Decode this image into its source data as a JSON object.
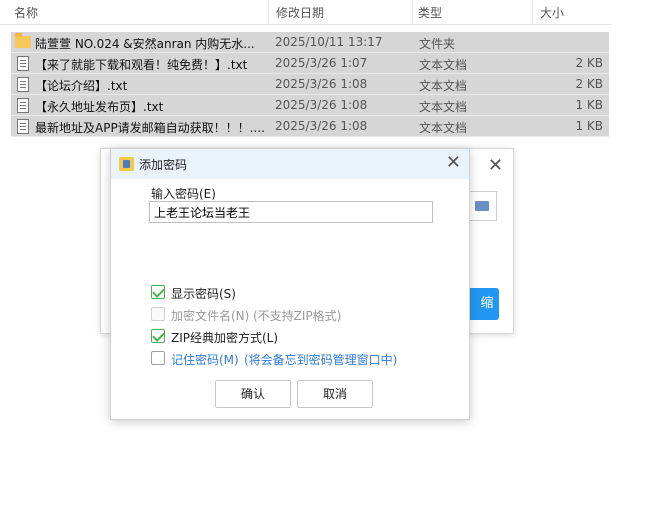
{
  "columns": {
    "name": "名称",
    "date": "修改日期",
    "type": "类型",
    "size": "大小"
  },
  "files": [
    {
      "icon": "folder-icon",
      "name": "陆萱萱 NO.024 &安然anran 内购无水...",
      "date": "2025/10/11 13:17",
      "type": "文件夹",
      "size": ""
    },
    {
      "icon": "text-file-icon",
      "name": "【来了就能下载和观看！纯免费！】.txt",
      "date": "2025/3/26 1:07",
      "type": "文本文档",
      "size": "2 KB"
    },
    {
      "icon": "text-file-icon",
      "name": "【论坛介绍】.txt",
      "date": "2025/3/26 1:08",
      "type": "文本文档",
      "size": "2 KB"
    },
    {
      "icon": "text-file-icon",
      "name": "【永久地址发布页】.txt",
      "date": "2025/3/26 1:08",
      "type": "文本文档",
      "size": "1 KB"
    },
    {
      "icon": "text-file-icon",
      "name": "最新地址及APP请发邮箱自动获取！！！....",
      "date": "2025/3/26 1:08",
      "type": "文本文档",
      "size": "1 KB"
    }
  ],
  "background_dialog": {
    "close_symbol": "✕",
    "compress_button_partial": "缩"
  },
  "dialog": {
    "title": "添加密码",
    "close_symbol": "✕",
    "password_label": "输入密码(E)",
    "password_value": "上老王论坛当老王",
    "options": [
      {
        "label": "显示密码(S)",
        "checked": true,
        "disabled": false,
        "note": ""
      },
      {
        "label": "加密文件名(N)",
        "checked": false,
        "disabled": true,
        "note": "(不支持ZIP格式)"
      },
      {
        "label": "ZIP经典加密方式(L)",
        "checked": true,
        "disabled": false,
        "note": ""
      },
      {
        "label": "记住密码(M)",
        "checked": false,
        "disabled": false,
        "note": "(将会备忘到密码管理窗口中)"
      }
    ],
    "ok_label": "确认",
    "cancel_label": "取消"
  },
  "colors": {
    "selected_row": "#d6d6d6",
    "titlebar": "#eaf2fb",
    "accent_blue": "#2196f3",
    "check_green": "#4caf50",
    "link_blue": "#2f7ad6"
  }
}
